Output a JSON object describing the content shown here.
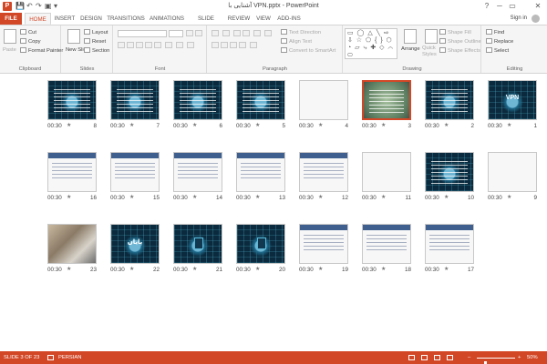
{
  "window": {
    "title": "آشنایی با VPN.pptx - PowerPoint",
    "help_glyph": "?",
    "minimize_glyph": "─",
    "restore_glyph": "▭",
    "close_glyph": "✕"
  },
  "quick_access": {
    "app_logo": "P",
    "save_glyph": "💾",
    "undo_glyph": "↶",
    "redo_glyph": "↷",
    "present_glyph": "▣",
    "more_glyph": "▾"
  },
  "tabs": [
    "FILE",
    "HOME",
    "INSERT",
    "DESIGN",
    "TRANSITIONS",
    "ANIMATIONS",
    "SLIDE SHOW",
    "REVIEW",
    "VIEW",
    "ADD-INS"
  ],
  "active_tab": "HOME",
  "account": {
    "sign_in": "Sign in"
  },
  "ribbon": {
    "clipboard": {
      "label": "Clipboard",
      "paste": "Paste",
      "cut": "Cut",
      "copy": "Copy",
      "format_painter": "Format Painter"
    },
    "slides": {
      "label": "Slides",
      "new_slide": "New Slide",
      "layout": "Layout",
      "reset": "Reset",
      "section": "Section"
    },
    "font": {
      "label": "Font"
    },
    "paragraph": {
      "label": "Paragraph",
      "text_direction": "Text Direction",
      "align_text": "Align Text",
      "convert_smartart": "Convert to SmartArt"
    },
    "drawing": {
      "label": "Drawing",
      "shapes_preview": "▭ ◯ △ ╲ ⇨ ⇩ ☆ ⬠ { } ⬡ ◔ ▱ ⤷ ✚ ◇ ⌒ ⬭",
      "arrange": "Arrange",
      "quick_styles": "Quick Styles",
      "shape_fill": "Shape Fill",
      "shape_outline": "Shape Outline",
      "shape_effects": "Shape Effects"
    },
    "editing": {
      "label": "Editing",
      "find": "Find",
      "replace": "Replace",
      "select": "Select"
    }
  },
  "slides": [
    {
      "num": "8",
      "time": "00:30",
      "style": "circuit-text"
    },
    {
      "num": "7",
      "time": "00:30",
      "style": "circuit-text"
    },
    {
      "num": "6",
      "time": "00:30",
      "style": "circuit-text"
    },
    {
      "num": "5",
      "time": "00:30",
      "style": "circuit-text"
    },
    {
      "num": "4",
      "time": "00:30",
      "style": "diagram"
    },
    {
      "num": "3",
      "time": "00:30",
      "style": "green",
      "selected": true
    },
    {
      "num": "2",
      "time": "00:30",
      "style": "circuit-text"
    },
    {
      "num": "1",
      "time": "00:30",
      "style": "circuit-title"
    },
    {
      "num": "16",
      "time": "00:30",
      "style": "screenshot"
    },
    {
      "num": "15",
      "time": "00:30",
      "style": "screenshot"
    },
    {
      "num": "14",
      "time": "00:30",
      "style": "screenshot"
    },
    {
      "num": "13",
      "time": "00:30",
      "style": "screenshot"
    },
    {
      "num": "12",
      "time": "00:30",
      "style": "screenshot"
    },
    {
      "num": "11",
      "time": "00:30",
      "style": "map"
    },
    {
      "num": "10",
      "time": "00:30",
      "style": "circuit-text"
    },
    {
      "num": "9",
      "time": "00:30",
      "style": "diagram"
    },
    {
      "num": "23",
      "time": "00:30",
      "style": "photo"
    },
    {
      "num": "22",
      "time": "00:30",
      "style": "circuit-end"
    },
    {
      "num": "21",
      "time": "00:30",
      "style": "circuit-lock"
    },
    {
      "num": "20",
      "time": "00:30",
      "style": "circuit-lock"
    },
    {
      "num": "19",
      "time": "00:30",
      "style": "screenshot"
    },
    {
      "num": "18",
      "time": "00:30",
      "style": "screenshot"
    },
    {
      "num": "17",
      "time": "00:30",
      "style": "screenshot"
    }
  ],
  "thumb_text": {
    "title_slide": "VPN",
    "end_slide": "پایان"
  },
  "status": {
    "slide_info": "SLIDE 3 OF 23",
    "language": "PERSIAN",
    "zoom": "50%",
    "zoom_fraction": 0.5,
    "zoom_minus": "–",
    "zoom_plus": "+"
  },
  "colors": {
    "accent": "#d24726",
    "ribbon_bg": "#f5f5f5"
  },
  "icons": [
    "powerpoint-logo-icon",
    "save-icon",
    "undo-icon",
    "redo-icon",
    "presentation-icon",
    "user-avatar-icon",
    "star-icon"
  ]
}
